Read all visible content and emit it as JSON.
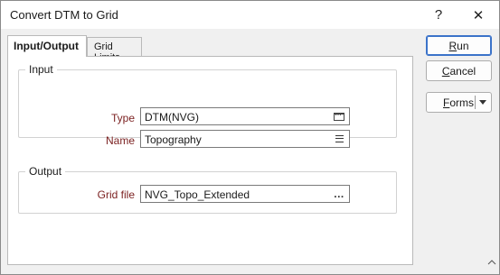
{
  "window": {
    "title": "Convert DTM to Grid",
    "help_glyph": "?",
    "close_glyph": "✕"
  },
  "tabs": [
    {
      "label": "Input/Output",
      "active": true
    },
    {
      "label": "Grid Limits",
      "active": false
    }
  ],
  "input_group": {
    "legend": "Input",
    "type_label": "Type",
    "type_value": "DTM(NVG)",
    "name_label": "Name",
    "name_value": "Topography"
  },
  "output_group": {
    "legend": "Output",
    "grid_file_label": "Grid file",
    "grid_file_value": "NVG_Topo_Extended",
    "grid_file_browse": "..."
  },
  "buttons": {
    "run_first": "R",
    "run_rest": "un",
    "cancel_first": "C",
    "cancel_rest": "ancel",
    "forms_first": "F",
    "forms_rest": "orms"
  },
  "colors": {
    "field_label": "#7a1f1f",
    "default_button_border": "#3b73c9"
  },
  "icons": {
    "type_field": "browse-icon",
    "name_field": "list-icon",
    "forms_dropdown": "chevron-down-icon",
    "bottom_right": "chevron-up-icon"
  }
}
